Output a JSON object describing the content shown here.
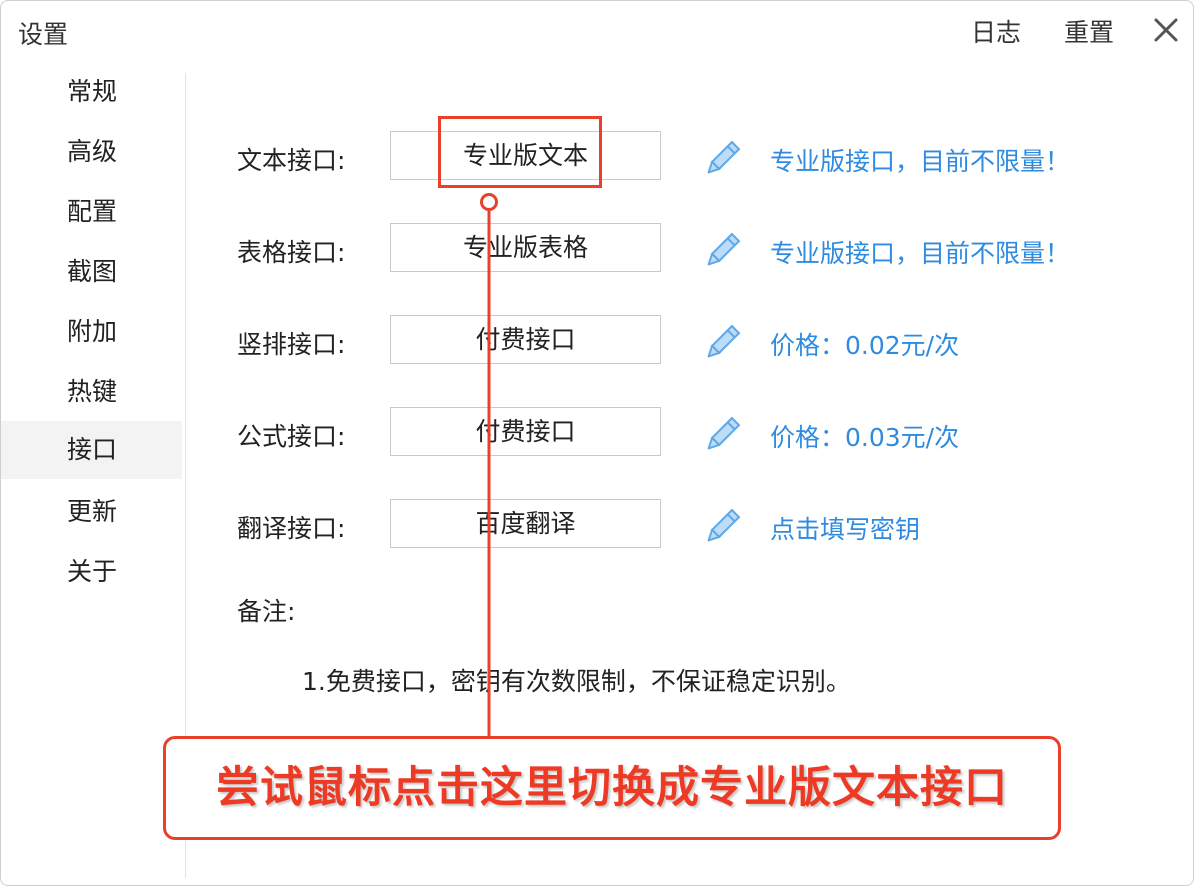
{
  "window": {
    "title": "设置",
    "log_label": "日志",
    "reset_label": "重置",
    "close_icon": "close-icon"
  },
  "sidebar": {
    "items": [
      {
        "label": "常规",
        "active": false
      },
      {
        "label": "高级",
        "active": false
      },
      {
        "label": "配置",
        "active": false
      },
      {
        "label": "截图",
        "active": false
      },
      {
        "label": "附加",
        "active": false
      },
      {
        "label": "热键",
        "active": false
      },
      {
        "label": "接口",
        "active": true
      },
      {
        "label": "更新",
        "active": false
      },
      {
        "label": "关于",
        "active": false
      }
    ]
  },
  "interfaces": {
    "rows": [
      {
        "label": "文本接口:",
        "value": "专业版文本",
        "link": "专业版接口，目前不限量！",
        "icon": "pencil-icon"
      },
      {
        "label": "表格接口:",
        "value": "专业版表格",
        "link": "专业版接口，目前不限量！",
        "icon": "pencil-icon"
      },
      {
        "label": "竖排接口:",
        "value": "付费接口",
        "link": "价格：0.02元/次",
        "icon": "pencil-icon"
      },
      {
        "label": "公式接口:",
        "value": "付费接口",
        "link": "价格：0.03元/次",
        "icon": "pencil-icon"
      },
      {
        "label": "翻译接口:",
        "value": "百度翻译",
        "link": "点击填写密钥",
        "icon": "pencil-icon"
      }
    ],
    "remark_label": "备注:",
    "remark_text": "1.免费接口，密钥有次数限制，不保证稳定识别。"
  },
  "annotation": {
    "callout_text": "尝试鼠标点击这里切换成专业版文本接口",
    "color": "#e8402a"
  },
  "colors": {
    "link": "#2f8be0",
    "active_sidebar": "#f3f3f3",
    "pencil": "#5ea8e8"
  }
}
